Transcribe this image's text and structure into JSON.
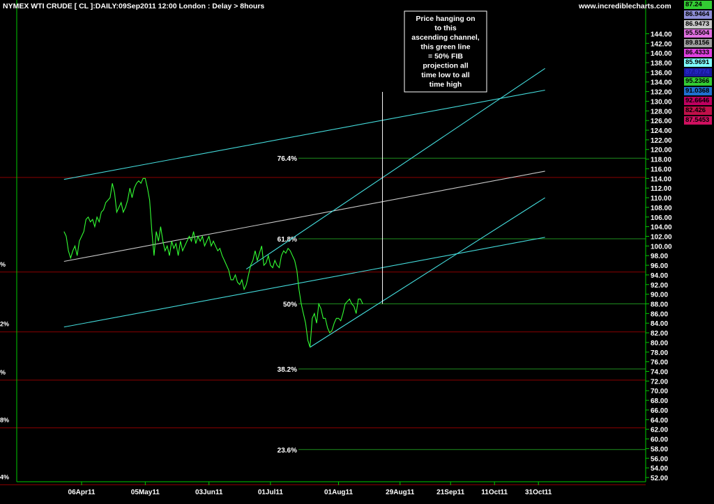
{
  "header": {
    "title": "NYMEX WTI CRUDE [ CL ]:DAILY:09Sep2011 12:00 London  : Delay > 8hours",
    "site": "www.incrediblecharts.com"
  },
  "annotation": {
    "lines": [
      "Price hanging on",
      "to this",
      "ascending channel,",
      "this green line",
      "= 50% FIB",
      "projection all",
      "time low to all",
      "time high"
    ]
  },
  "colors": {
    "background": "#000000",
    "price_line": "#33ff33",
    "channel": "#44dddd",
    "mid_channel": "#cccccc",
    "fib_line": "#1f8f1f",
    "red_line": "#8b0000",
    "axis": "#00cc00",
    "text": "#ffffff"
  },
  "price_boxes": [
    {
      "value": "87.24",
      "bg": "#33cc33",
      "fg": "#000000"
    },
    {
      "value": "86.9464",
      "bg": "#8e8ed6",
      "fg": "#000000"
    },
    {
      "value": "86.9473",
      "bg": "#c9c9c9",
      "fg": "#000000"
    },
    {
      "value": "95.5504",
      "bg": "#e070e0",
      "fg": "#000000"
    },
    {
      "value": "89.8156",
      "bg": "#a0a0a0",
      "fg": "#000000"
    },
    {
      "value": "86.4333",
      "bg": "#e040e0",
      "fg": "#000000"
    },
    {
      "value": "85.9691",
      "bg": "#80ffff",
      "fg": "#000000"
    },
    {
      "value": "87.9774",
      "bg": "#1a1aa0",
      "fg": "#2a2ad0"
    },
    {
      "value": "95.2366",
      "bg": "#33cc33",
      "fg": "#000000"
    },
    {
      "value": "91.0368",
      "bg": "#2070d0",
      "fg": "#000000"
    },
    {
      "value": "92.6646",
      "bg": "#c00060",
      "fg": "#000000"
    },
    {
      "value": "82.426",
      "bg": "#c0104a",
      "fg": "#000000"
    },
    {
      "value": "87.5453",
      "bg": "#d01060",
      "fg": "#000000"
    }
  ],
  "chart_data": {
    "type": "line",
    "title": "NYMEX WTI CRUDE [ CL ]:DAILY:09Sep2011 12:00 London  : Delay > 8hours",
    "x_ticks": [
      {
        "label": "06Apr11",
        "day": 5
      },
      {
        "label": "05May11",
        "day": 34
      },
      {
        "label": "03Jun11",
        "day": 63
      },
      {
        "label": "01Jul11",
        "day": 91
      },
      {
        "label": "01Aug11",
        "day": 122
      },
      {
        "label": "29Aug11",
        "day": 150
      },
      {
        "label": "21Sep11",
        "day": 173
      },
      {
        "label": "11Oct11",
        "day": 193
      },
      {
        "label": "31Oct11",
        "day": 213
      }
    ],
    "ylim": [
      50,
      148
    ],
    "y_ticks": [
      52,
      54,
      56,
      58,
      60,
      62,
      64,
      66,
      68,
      70,
      72,
      74,
      76,
      78,
      80,
      82,
      84,
      86,
      88,
      90,
      92,
      94,
      96,
      98,
      100,
      102,
      104,
      106,
      108,
      110,
      112,
      114,
      116,
      118,
      120,
      122,
      124,
      126,
      128,
      130,
      132,
      134,
      136,
      138,
      140,
      142,
      144
    ],
    "series": [
      {
        "values": [
          [
            -3,
            103
          ],
          [
            -2,
            102
          ],
          [
            -1,
            99
          ],
          [
            0,
            97.5
          ],
          [
            1,
            99
          ],
          [
            2,
            100
          ],
          [
            3,
            98
          ],
          [
            4,
            101
          ],
          [
            5,
            102
          ],
          [
            6,
            103
          ],
          [
            7,
            105.5
          ],
          [
            8,
            106
          ],
          [
            9,
            105
          ],
          [
            10,
            105.5
          ],
          [
            11,
            104
          ],
          [
            12,
            106
          ],
          [
            13,
            105
          ],
          [
            14,
            107
          ],
          [
            15,
            107.5
          ],
          [
            16,
            109
          ],
          [
            17,
            109.5
          ],
          [
            18,
            110
          ],
          [
            19,
            113
          ],
          [
            20,
            111
          ],
          [
            21,
            107
          ],
          [
            22,
            108
          ],
          [
            23,
            109
          ],
          [
            24,
            107
          ],
          [
            25,
            108
          ],
          [
            26,
            109.5
          ],
          [
            27,
            112
          ],
          [
            28,
            110
          ],
          [
            29,
            112
          ],
          [
            30,
            113
          ],
          [
            31,
            113.5
          ],
          [
            32,
            113
          ],
          [
            33,
            114
          ],
          [
            34,
            114
          ],
          [
            35,
            112
          ],
          [
            36,
            109.5
          ],
          [
            37,
            103
          ],
          [
            38,
            98
          ],
          [
            39,
            103
          ],
          [
            40,
            101
          ],
          [
            41,
            104
          ],
          [
            42,
            101
          ],
          [
            43,
            99
          ],
          [
            44,
            100
          ],
          [
            45,
            98
          ],
          [
            46,
            101
          ],
          [
            47,
            99.5
          ],
          [
            48,
            100.5
          ],
          [
            49,
            98
          ],
          [
            50,
            101
          ],
          [
            51,
            99
          ],
          [
            52,
            100
          ],
          [
            53,
            101
          ],
          [
            54,
            102
          ],
          [
            55,
            101
          ],
          [
            56,
            103
          ],
          [
            57,
            100.5
          ],
          [
            58,
            102
          ],
          [
            59,
            101
          ],
          [
            60,
            102
          ],
          [
            61,
            100
          ],
          [
            62,
            101
          ],
          [
            63,
            102
          ],
          [
            64,
            100
          ],
          [
            65,
            101
          ],
          [
            66,
            100
          ],
          [
            67,
            99
          ],
          [
            68,
            99.5
          ],
          [
            69,
            98
          ],
          [
            70,
            97
          ],
          [
            71,
            96
          ],
          [
            72,
            95
          ],
          [
            73,
            93
          ],
          [
            74,
            93
          ],
          [
            75,
            94
          ],
          [
            76,
            92.5
          ],
          [
            77,
            92
          ],
          [
            78,
            93
          ],
          [
            79,
            91
          ],
          [
            80,
            92
          ],
          [
            81,
            94
          ],
          [
            82,
            96
          ],
          [
            83,
            97
          ],
          [
            84,
            99
          ],
          [
            85,
            97
          ],
          [
            86,
            98.5
          ],
          [
            87,
            100
          ],
          [
            88,
            96
          ],
          [
            89,
            96.5
          ],
          [
            90,
            98
          ],
          [
            91,
            96
          ],
          [
            92,
            95.5
          ],
          [
            93,
            97
          ],
          [
            94,
            96
          ],
          [
            95,
            95.5
          ],
          [
            96,
            98
          ],
          [
            97,
            99
          ],
          [
            98,
            98.5
          ],
          [
            99,
            99.5
          ],
          [
            100,
            99
          ],
          [
            101,
            98
          ],
          [
            102,
            97
          ],
          [
            103,
            95
          ],
          [
            104,
            91
          ],
          [
            105,
            88
          ],
          [
            106,
            86
          ],
          [
            107,
            84
          ],
          [
            108,
            80.5
          ],
          [
            109,
            79
          ],
          [
            110,
            85
          ],
          [
            111,
            86
          ],
          [
            112,
            84
          ],
          [
            113,
            88
          ],
          [
            114,
            87
          ],
          [
            115,
            85
          ],
          [
            116,
            85
          ],
          [
            117,
            83
          ],
          [
            118,
            82
          ],
          [
            119,
            82.5
          ],
          [
            120,
            84
          ],
          [
            121,
            85
          ],
          [
            122,
            85
          ],
          [
            123,
            84.5
          ],
          [
            124,
            86
          ],
          [
            125,
            88
          ],
          [
            126,
            88.5
          ],
          [
            127,
            89
          ],
          [
            128,
            88
          ],
          [
            129,
            87.5
          ],
          [
            130,
            86
          ],
          [
            131,
            89
          ],
          [
            132,
            89
          ],
          [
            133,
            88
          ]
        ]
      }
    ],
    "fib_levels": [
      {
        "label": "76.4%",
        "price": 118.2
      },
      {
        "label": "61.8%",
        "price": 101.5
      },
      {
        "label": "50%",
        "price": 88.0
      },
      {
        "label": "38.2%",
        "price": 74.5
      },
      {
        "label": "23.6%",
        "price": 57.8
      }
    ],
    "red_levels": [
      114.2,
      94.6,
      82.2,
      72.2,
      62.3,
      50.5
    ],
    "left_fib_labels": [
      "%",
      "2%",
      "%",
      "8%",
      "4%"
    ],
    "channel_lines": [
      {
        "role": "upper-channel",
        "from": [
          -3,
          113.8
        ],
        "to": [
          216,
          132.3
        ]
      },
      {
        "role": "mid-channel",
        "from": [
          -3,
          96.8
        ],
        "to": [
          216,
          115.5
        ]
      },
      {
        "role": "lower-channel",
        "from": [
          -3,
          83.2
        ],
        "to": [
          216,
          101.8
        ]
      },
      {
        "role": "steep-upper",
        "from": [
          80,
          95.2
        ],
        "to": [
          216,
          136.8
        ]
      },
      {
        "role": "steep-lower",
        "from": [
          109,
          79.0
        ],
        "to": [
          216,
          110.0
        ]
      }
    ],
    "annotation_pointer": {
      "day": 142,
      "price": 88.0
    }
  }
}
